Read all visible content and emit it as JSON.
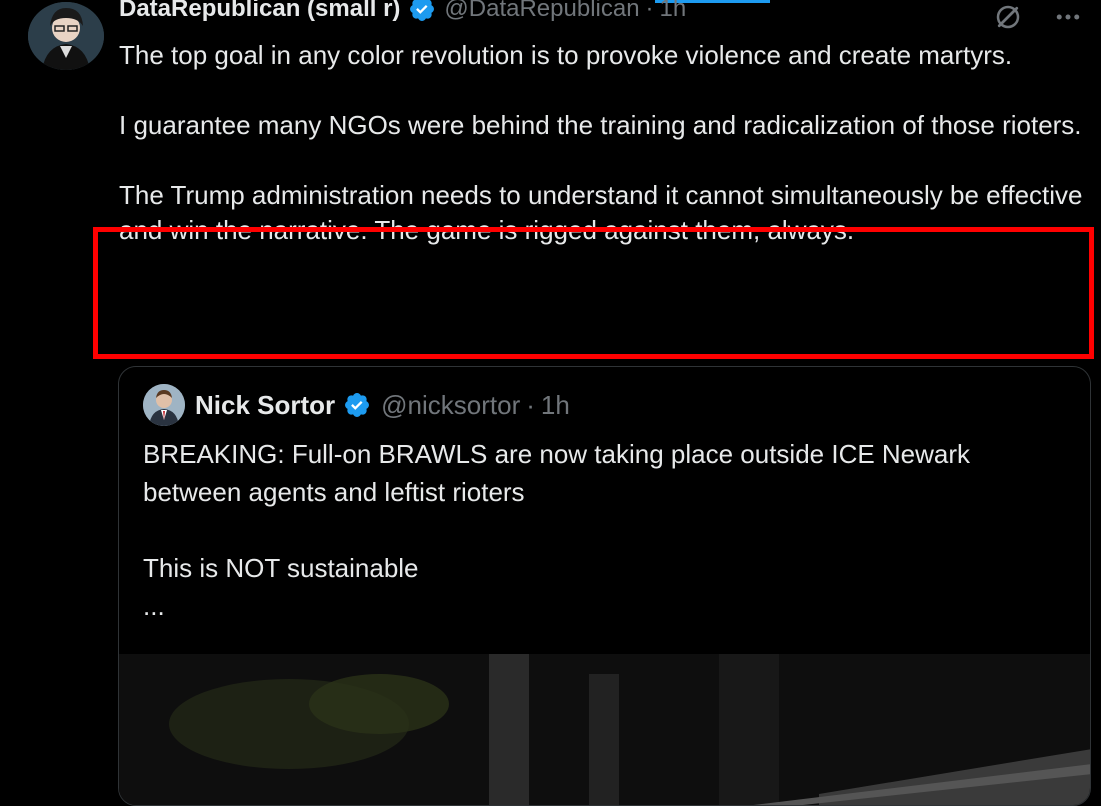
{
  "colors": {
    "background": "#000000",
    "text_primary": "#e7e9ea",
    "text_secondary": "#71767b",
    "verified_blue": "#1d9bf0",
    "highlight_red": "#ff0000",
    "card_border": "#2f3336"
  },
  "tweet": {
    "author": {
      "display_name": "DataRepublican (small r)",
      "handle": "@DataRepublican",
      "verified_icon": "verified-badge-icon"
    },
    "dot": "·",
    "time": "1h",
    "actions": {
      "grok_icon": "grok-icon",
      "more_icon": "more-icon"
    },
    "paragraphs": [
      "The top goal in any color revolution is to provoke violence and create martyrs.",
      "I guarantee many NGOs were behind the training and radicalization of those rioters.",
      "The Trump administration needs to understand it cannot simultaneously be effective and win the narrative. The game is rigged against them, always."
    ]
  },
  "quoted_tweet": {
    "author": {
      "display_name": "Nick Sortor",
      "handle": "@nicksortor",
      "verified_icon": "verified-badge-icon"
    },
    "dot": "·",
    "time": "1h",
    "paragraphs": [
      "BREAKING: Full-on BRAWLS are now taking place outside ICE Newark between agents and leftist rioters",
      "This is NOT sustainable",
      "..."
    ]
  }
}
